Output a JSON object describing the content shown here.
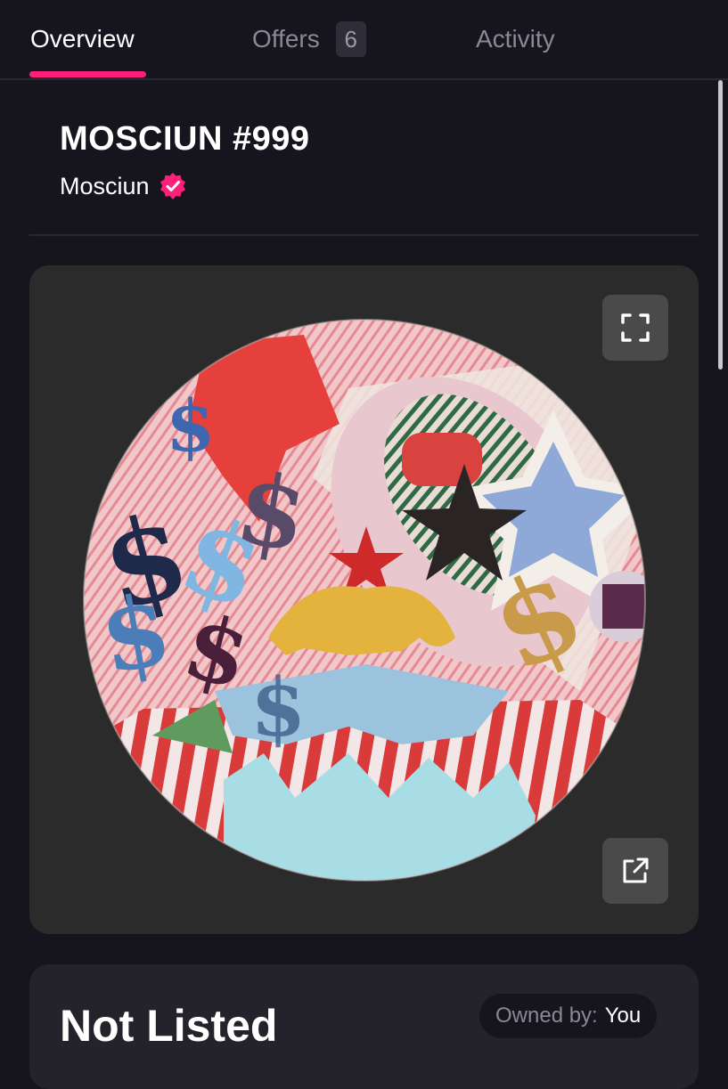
{
  "tabs": {
    "overview": "Overview",
    "offers": "Offers",
    "offers_count": "6",
    "activity": "Activity"
  },
  "nft": {
    "title": "MOSCIUN #999",
    "collection": "Mosciun"
  },
  "media": {
    "fullscreen_icon": "fullscreen-icon",
    "external_icon": "external-link-icon"
  },
  "listing": {
    "status": "Not Listed",
    "owned_by_label": "Owned by:",
    "owner": "You"
  },
  "colors": {
    "accent": "#ff1f7a",
    "background": "#16141c",
    "card": "#24222b"
  }
}
